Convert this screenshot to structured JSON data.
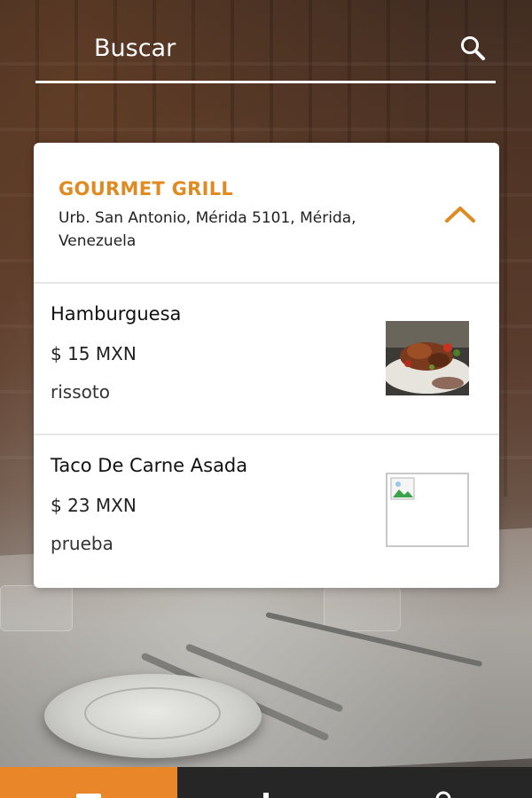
{
  "search": {
    "placeholder": "Buscar"
  },
  "restaurant": {
    "name": "GOURMET GRILL",
    "address": "Urb. San Antonio, Mérida 5101, Mérida, Venezuela"
  },
  "items": [
    {
      "name": "Hamburguesa",
      "price": "$ 15 MXN",
      "description": "rissoto"
    },
    {
      "name": "Taco De Carne Asada",
      "price": "$ 23 MXN",
      "description": "prueba"
    }
  ],
  "colors": {
    "accent": "#e08a22",
    "nav_active": "#e9862a",
    "nav_bg": "#262626"
  },
  "icons": {
    "search": "search-icon",
    "collapse": "chevron-up-icon"
  }
}
